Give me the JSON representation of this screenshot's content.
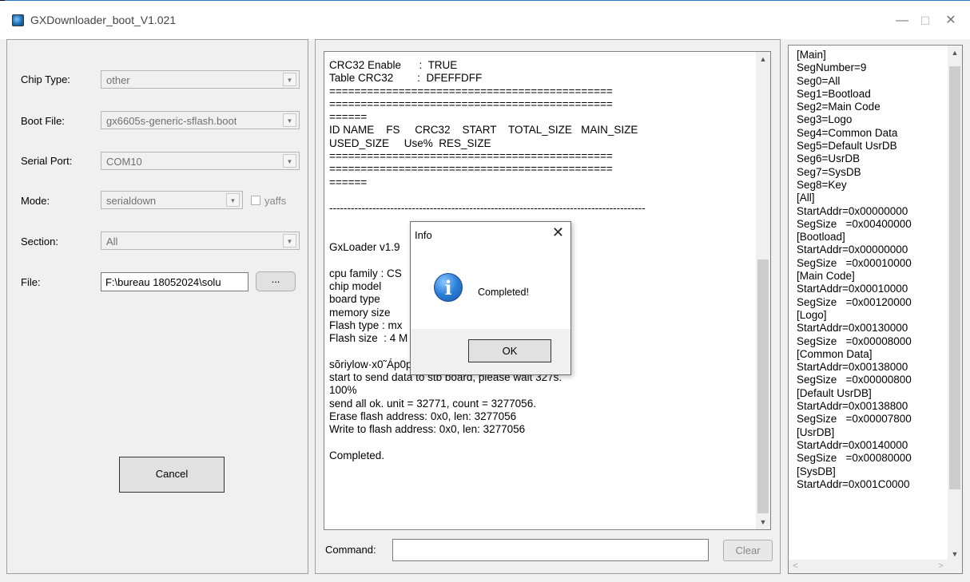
{
  "window": {
    "title": "GXDownloader_boot_V1.021",
    "minimize_glyph": "—",
    "maximize_glyph": "☐",
    "close_glyph": "✕"
  },
  "left": {
    "chip_type": {
      "label": "Chip Type:",
      "value": "other"
    },
    "boot_file": {
      "label": "Boot File:",
      "value": "gx6605s-generic-sflash.boot"
    },
    "serial_port": {
      "label": "Serial Port:",
      "value": "COM10"
    },
    "mode": {
      "label": "Mode:",
      "value": "serialdown",
      "checkbox_label": "yaffs"
    },
    "section": {
      "label": "Section:",
      "value": "All"
    },
    "file": {
      "label": "File:",
      "value": "F:\\bureau 18052024\\solu",
      "browse_label": "..."
    },
    "cancel_label": "Cancel"
  },
  "log": {
    "lines": [
      "CRC32 Enable      :  TRUE",
      "Table CRC32        :  DFEFFDFF",
      "=============================================",
      "=============================================",
      "======",
      "ID NAME    FS     CRC32    START    TOTAL_SIZE   MAIN_SIZE",
      "USED_SIZE     Use%  RES_SIZE",
      "=============================================",
      "=============================================",
      "======",
      "",
      "----------------------------------------------------------------------------------------",
      "",
      "",
      "GxLoader v1.9",
      "",
      "cpu family : CS",
      "chip model",
      "board type",
      "memory size",
      "Flash type : mx",
      "Flash size  : 4 M",
      "",
      "sõriylow·x0˜Áp0p0&ººÁu6",
      "start to send data to stb board, please wait 327s.",
      "100%",
      "send all ok. unit = 32771, count = 3277056.",
      "Erase flash address: 0x0, len: 3277056",
      "Write to flash address: 0x0, len: 3277056",
      "",
      "Completed."
    ],
    "command_label": "Command:",
    "command_value": "",
    "clear_label": "Clear"
  },
  "ini": {
    "lines": [
      "[Main]",
      "SegNumber=9",
      "Seg0=All",
      "Seg1=Bootload",
      "Seg2=Main Code",
      "Seg3=Logo",
      "Seg4=Common Data",
      "Seg5=Default UsrDB",
      "Seg6=UsrDB",
      "Seg7=SysDB",
      "Seg8=Key",
      "[All]",
      "StartAddr=0x00000000",
      "SegSize   =0x00400000",
      "[Bootload]",
      "StartAddr=0x00000000",
      "SegSize   =0x00010000",
      "[Main Code]",
      "StartAddr=0x00010000",
      "SegSize   =0x00120000",
      "[Logo]",
      "StartAddr=0x00130000",
      "SegSize   =0x00008000",
      "[Common Data]",
      "StartAddr=0x00138000",
      "SegSize   =0x00000800",
      "[Default UsrDB]",
      "StartAddr=0x00138800",
      "SegSize   =0x00007800",
      "[UsrDB]",
      "StartAddr=0x00140000",
      "SegSize   =0x00080000",
      "[SysDB]",
      "StartAddr=0x001C0000"
    ]
  },
  "dialog": {
    "title": "Info",
    "message": "Completed!",
    "ok_label": "OK",
    "close_glyph": "✕",
    "icon_glyph": "i"
  },
  "icons": {
    "combo_arrow": "▼",
    "scroll_up": "▲",
    "scroll_down": "▼",
    "scroll_left": "<",
    "scroll_right": ">"
  }
}
